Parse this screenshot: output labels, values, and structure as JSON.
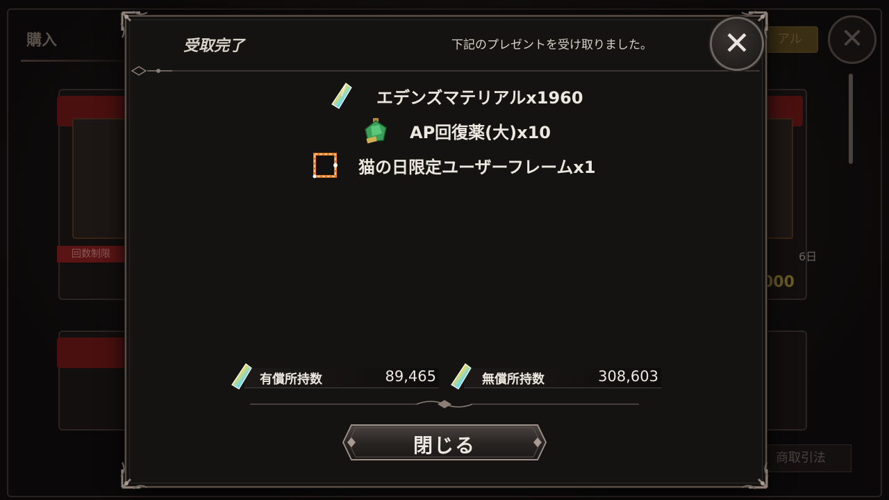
{
  "background": {
    "title": "購入",
    "tab_label": "アル",
    "limit_badge": "回数制限",
    "days": "6日",
    "price": "000",
    "trade_button": "商取引法"
  },
  "modal": {
    "title": "受取完了",
    "subtitle": "下記のプレゼントを受け取りました。",
    "close_icon": "close-x-icon",
    "items": [
      {
        "icon": "crystal-icon",
        "label": "エデンズマテリアルx1960"
      },
      {
        "icon": "green-potion-icon",
        "label": "AP回復薬(大)x10"
      },
      {
        "icon": "user-frame-icon",
        "label": "猫の日限定ユーザーフレームx1"
      }
    ],
    "balances": [
      {
        "label": "有償所持数",
        "value": "89,465"
      },
      {
        "label": "無償所持数",
        "value": "308,603"
      }
    ],
    "close_button_label": "閉じる"
  },
  "colors": {
    "panel": "#151312",
    "border": "#5a4e48",
    "text": "#ece8e0"
  }
}
